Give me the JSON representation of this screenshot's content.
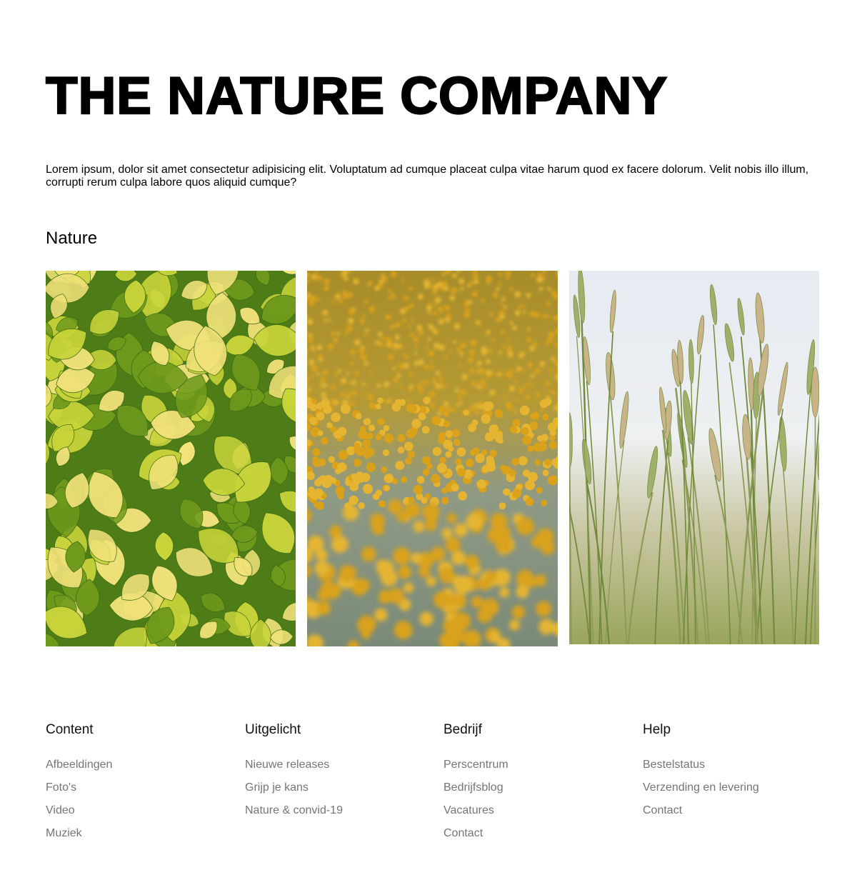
{
  "header": {
    "title": "THE NATURE COMPANY",
    "intro": "Lorem ipsum, dolor sit amet consectetur adipisicing elit. Voluptatum ad cumque placeat culpa vitae harum quod ex facere dolorum. Velit nobis illo illum, corrupti rerum culpa labore quos aliquid cumque?"
  },
  "gallery": {
    "title": "Nature",
    "images": [
      {
        "name": "yellow-green-leaves-photo",
        "palette": [
          "#6f9a1c",
          "#c8d43a",
          "#f1e27a",
          "#3d6b14"
        ]
      },
      {
        "name": "yellow-flower-field-photo",
        "palette": [
          "#d9a21a",
          "#9aa69a",
          "#7e8b72",
          "#e5b532"
        ]
      },
      {
        "name": "wheat-field-photo",
        "palette": [
          "#dfe6ee",
          "#9fb06a",
          "#c9b48a",
          "#5f7a36"
        ]
      }
    ]
  },
  "footer": {
    "columns": [
      {
        "heading": "Content",
        "links": [
          "Afbeeldingen",
          "Foto's",
          "Video",
          "Muziek"
        ]
      },
      {
        "heading": "Uitgelicht",
        "links": [
          "Nieuwe releases",
          "Grijp je kans",
          "Nature & convid-19"
        ]
      },
      {
        "heading": "Bedrijf",
        "links": [
          "Perscentrum",
          "Bedrijfsblog",
          "Vacatures",
          "Contact"
        ]
      },
      {
        "heading": "Help",
        "links": [
          "Bestelstatus",
          "Verzending en levering",
          "Contact"
        ]
      }
    ]
  },
  "colors": {
    "text": "#000000",
    "link": "#757575",
    "background": "#ffffff"
  }
}
